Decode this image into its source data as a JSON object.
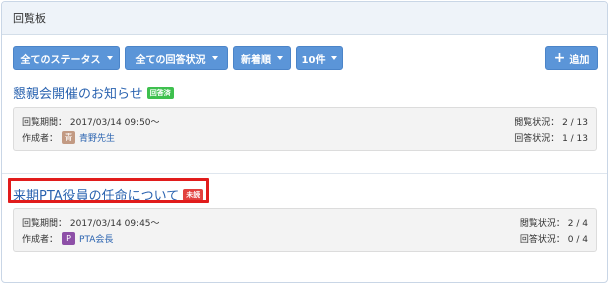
{
  "panel": {
    "title": "回覧板"
  },
  "toolbar": {
    "status_filter": "全てのステータス",
    "answer_filter": "全ての回答状況",
    "sort": "新着順",
    "count": "10件",
    "add": "追加"
  },
  "items": [
    {
      "title": "懇親会開催のお知らせ",
      "badge": "回答済",
      "badge_color": "#3ec04e",
      "period": "回覧期間： 2017/03/14 09:50〜",
      "author_label": "作成者：",
      "avatar": "青",
      "author": "青野先生",
      "read_status": "閲覧状況： 2 / 13",
      "answer_status": "回答状況： 1 / 13"
    },
    {
      "title": "来期PTA役員の任命について",
      "badge": "未読",
      "badge_color": "#e2413e",
      "period": "回覧期間： 2017/03/14 09:45〜",
      "author_label": "作成者：",
      "avatar": "P",
      "author": "PTA会長",
      "read_status": "閲覧状況： 2 / 4",
      "answer_status": "回答状況： 0 / 4"
    }
  ]
}
